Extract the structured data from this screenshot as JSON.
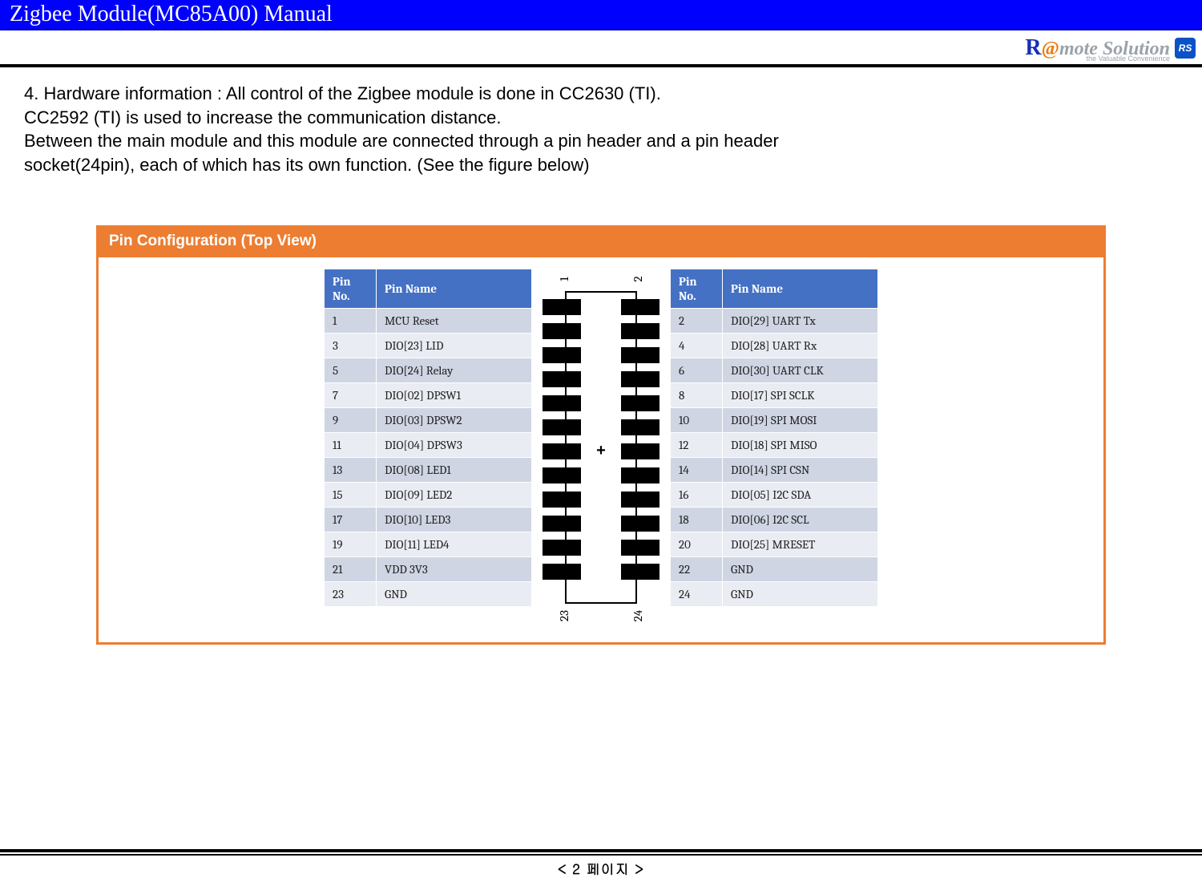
{
  "title": "Zigbee Module(MC85A00) Manual",
  "logo": {
    "main_prefix": "R",
    "main_at": "@",
    "main_rest": "mote Solution",
    "sub": "the Valuable Convenience",
    "badge": "RS"
  },
  "hardware_text_lines": [
    "4. Hardware information : All control of the Zigbee module is done in CC2630 (TI).",
    "CC2592 (TI) is used to increase the communication distance.",
    "Between the main module and this module are connected through a pin header and a pin header",
    "socket(24pin), each of which has its own function. (See the figure below)"
  ],
  "config_title": "Pin Configuration (Top View)",
  "table_headers": {
    "no": "Pin No.",
    "name": "Pin Name"
  },
  "left_pins": [
    {
      "no": "1",
      "name": "MCU Reset"
    },
    {
      "no": "3",
      "name": "DIO[23] LID"
    },
    {
      "no": "5",
      "name": "DIO[24] Relay"
    },
    {
      "no": "7",
      "name": "DIO[02] DPSW1"
    },
    {
      "no": "9",
      "name": "DIO[03] DPSW2"
    },
    {
      "no": "11",
      "name": "DIO[04] DPSW3"
    },
    {
      "no": "13",
      "name": "DIO[08] LED1"
    },
    {
      "no": "15",
      "name": "DIO[09] LED2"
    },
    {
      "no": "17",
      "name": "DIO[10] LED3"
    },
    {
      "no": "19",
      "name": "DIO[11] LED4"
    },
    {
      "no": "21",
      "name": "VDD 3V3"
    },
    {
      "no": "23",
      "name": "GND"
    }
  ],
  "right_pins": [
    {
      "no": "2",
      "name": "DIO[29] UART Tx"
    },
    {
      "no": "4",
      "name": "DIO[28] UART Rx"
    },
    {
      "no": "6",
      "name": "DIO[30] UART CLK"
    },
    {
      "no": "8",
      "name": "DIO[17] SPI SCLK"
    },
    {
      "no": "10",
      "name": "DIO[19] SPI MOSI"
    },
    {
      "no": "12",
      "name": "DIO[18] SPI MISO"
    },
    {
      "no": "14",
      "name": "DIO[14] SPI CSN"
    },
    {
      "no": "16",
      "name": "DIO[05] I2C SDA"
    },
    {
      "no": "18",
      "name": "DIO[06] I2C SCL"
    },
    {
      "no": "20",
      "name": "DIO[25] MRESET"
    },
    {
      "no": "22",
      "name": "GND"
    },
    {
      "no": "24",
      "name": "GND"
    }
  ],
  "chip_corners": {
    "tl": "1",
    "tr": "2",
    "bl": "23",
    "br": "24"
  },
  "chip_center": "+",
  "footer": "< 2 페이지 >"
}
